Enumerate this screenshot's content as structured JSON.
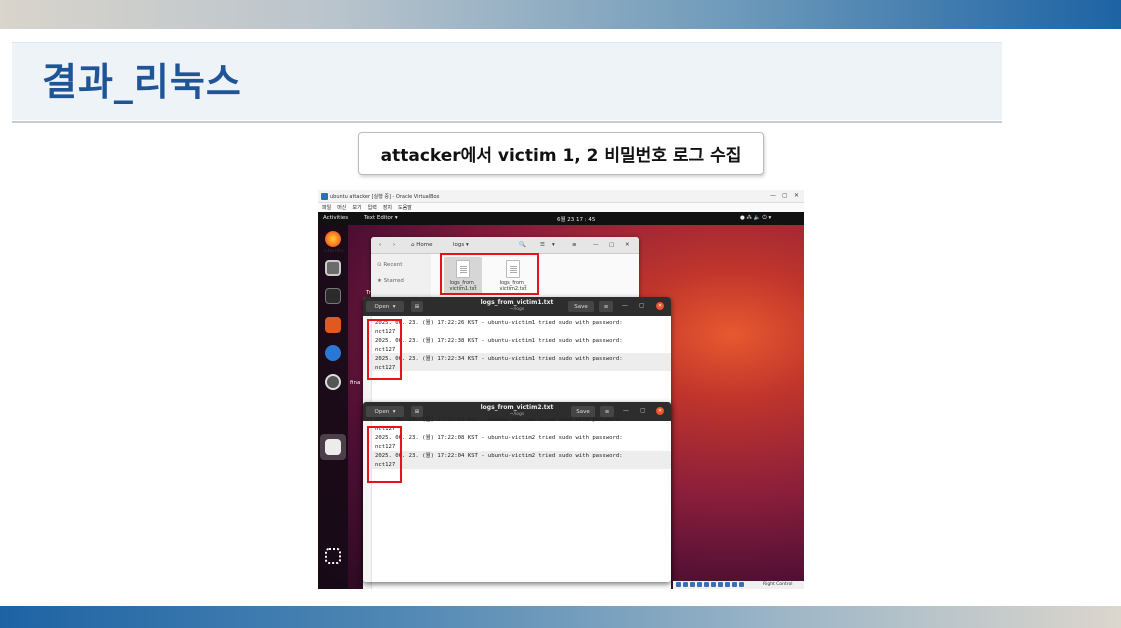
{
  "slide": {
    "title": "결과_리눅스",
    "caption": "attacker에서 victim 1, 2 비밀번호 로그 수집"
  },
  "vbox": {
    "window_title": "ubuntu attacker [실행 중] - Oracle VirtualBox",
    "menu": [
      "파일",
      "머신",
      "보기",
      "입력",
      "장치",
      "도움말"
    ],
    "minimize": "—",
    "maximize": "▢",
    "close": "✕"
  },
  "gnome": {
    "activities": "Activities",
    "app_menu": "Text Editor ▾",
    "clock": "6월 23  17 : 45",
    "tray": "● ⁂ 🔈 ⏻ ▾"
  },
  "desktop": {
    "label1": "ubuntu",
    "label2": "Trash",
    "label3": "fina"
  },
  "file_manager": {
    "back": "‹",
    "forward": "›",
    "home_label": "⌂  Home",
    "folder_label": "logs  ▾",
    "search": "🔍",
    "view1": "☰",
    "view2": "▾",
    "menu": "≡",
    "min": "—",
    "max": "▢",
    "close": "✕",
    "sidebar": [
      "⊙  Recent",
      "★  Starred"
    ],
    "files": [
      "logs_from_\nvictim1.txt",
      "logs_from_\nvictim2.txt"
    ]
  },
  "editor1": {
    "open": "Open",
    "open_arrow": "▾",
    "new_tab": "⊞",
    "name": "logs_from_victim1.txt",
    "path": "~/logs",
    "save": "Save",
    "menu": "≡",
    "min": "—",
    "max": "▢",
    "close": "✕",
    "lines": [
      "2025. 06. 23. (월) 17:22:26 KST - ubuntu-victim1 tried sudo with password:",
      "nct127",
      "2025. 06. 23. (월) 17:22:38 KST - ubuntu-victim1 tried sudo with password:",
      "nct127",
      "2025. 06. 23. (월) 17:22:34 KST - ubuntu-victim1 tried sudo with password:",
      "nct127"
    ]
  },
  "editor2": {
    "open": "Open",
    "open_arrow": "▾",
    "new_tab": "⊞",
    "name": "logs_from_victim2.txt",
    "path": "~/logs",
    "save": "Save",
    "menu": "≡",
    "min": "—",
    "max": "▢",
    "close": "✕",
    "lines": [
      "2025. 06. 23. (월) 17:21:52 KST - ubuntu-victim2 tried sudo with password:",
      "nct127",
      "2025. 06. 23. (월) 17:22:08 KST - ubuntu-victim2 tried sudo with password:",
      "nct127",
      "2025. 06. 23. (월) 17:22:04 KST - ubuntu-victim2 tried sudo with password:",
      "nct127"
    ]
  },
  "taskbar": {
    "host_key": "Right Control"
  },
  "colors": {
    "title_blue": "#1f5597",
    "highlight_red": "#e8121b",
    "ubuntu_orange": "#e9542b"
  }
}
